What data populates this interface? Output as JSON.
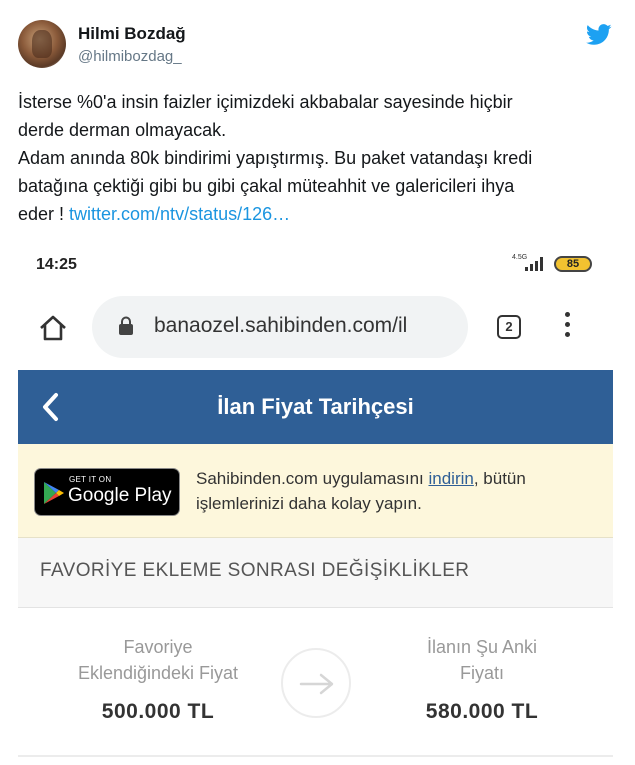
{
  "tweet": {
    "author_name": "Hilmi Bozdağ",
    "author_handle": "@hilmibozdag_",
    "text_line1": "İsterse %0'a insin faizler içimizdeki akbabalar sayesinde hiçbir",
    "text_line2": "derde derman olmayacak.",
    "text_line3": "Adam anında 80k bindirimi yapıştırmış. Bu paket vatandaşı kredi",
    "text_line4": "batağına çektiği gibi bu gibi çakal müteahhit ve galericileri ihya",
    "text_line5_prefix": "eder ! ",
    "link_text": "twitter.com/ntv/status/126…",
    "brand_color": "#1da1f2"
  },
  "phone": {
    "status": {
      "time": "14:25",
      "network": "4.5G",
      "battery": "85"
    },
    "browser": {
      "url": "banaozel.sahibinden.com/il",
      "tab_count": "2"
    },
    "page": {
      "title": "İlan Fiyat Tarihçesi",
      "header_color": "#2f5f96",
      "banner": {
        "store_small": "GET IT ON",
        "store_big": "Google Play",
        "text_before": "Sahibinden.com uygulamasını ",
        "link": "indirin",
        "text_after": ", bütün işlemlerinizi daha kolay yapın."
      },
      "section_title": "FAVORİYE EKLEME SONRASI DEĞİŞİKLİKLER",
      "price_before": {
        "label_line1": "Favoriye",
        "label_line2": "Eklendiğindeki Fiyat",
        "value": "500.000 TL"
      },
      "price_now": {
        "label_line1": "İlanın Şu Anki",
        "label_line2": "Fiyatı",
        "value": "580.000 TL"
      }
    }
  }
}
